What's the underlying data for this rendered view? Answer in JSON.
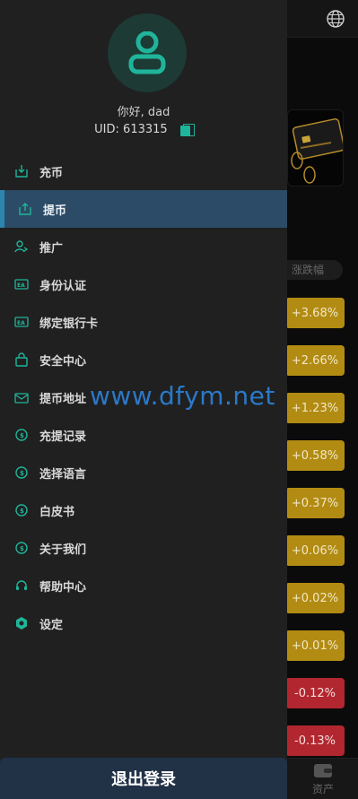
{
  "background": {
    "filter_chip": "涨跌幅",
    "changes": [
      {
        "text": "+3.68%",
        "dir": "up"
      },
      {
        "text": "+2.66%",
        "dir": "up"
      },
      {
        "text": "+1.23%",
        "dir": "up"
      },
      {
        "text": "+0.58%",
        "dir": "up"
      },
      {
        "text": "+0.37%",
        "dir": "up"
      },
      {
        "text": "+0.06%",
        "dir": "up"
      },
      {
        "text": "+0.02%",
        "dir": "up"
      },
      {
        "text": "+0.01%",
        "dir": "up"
      },
      {
        "text": "-0.12%",
        "dir": "down"
      },
      {
        "text": "-0.13%",
        "dir": "down"
      }
    ],
    "bottom_nav_assets": "资产"
  },
  "drawer": {
    "greeting": "你好, dad",
    "uid": "UID: 613315",
    "menu": [
      {
        "label": "充币",
        "icon": "deposit-icon",
        "active": false
      },
      {
        "label": "提币",
        "icon": "withdraw-icon",
        "active": true
      },
      {
        "label": "推广",
        "icon": "user-share-icon",
        "active": false
      },
      {
        "label": "身份认证",
        "icon": "id-card-icon",
        "active": false
      },
      {
        "label": "绑定银行卡",
        "icon": "bank-card-icon",
        "active": false
      },
      {
        "label": "安全中心",
        "icon": "lock-icon",
        "active": false
      },
      {
        "label": "提币地址",
        "icon": "mail-icon",
        "active": false
      },
      {
        "label": "充提记录",
        "icon": "coin-icon",
        "active": false
      },
      {
        "label": "选择语言",
        "icon": "coin-icon",
        "active": false
      },
      {
        "label": "白皮书",
        "icon": "coin-icon",
        "active": false
      },
      {
        "label": "关于我们",
        "icon": "coin-icon",
        "active": false
      },
      {
        "label": "帮助中心",
        "icon": "headset-icon",
        "active": false
      },
      {
        "label": "设定",
        "icon": "gear-icon",
        "active": false
      }
    ],
    "logout_label": "退出登录"
  },
  "watermark": "www.dfym.net",
  "colors": {
    "accent": "#1fb59a",
    "active_bg": "#2c4b66",
    "up": "#b28b12",
    "down": "#b2262f",
    "watermark": "#2a79c8"
  }
}
